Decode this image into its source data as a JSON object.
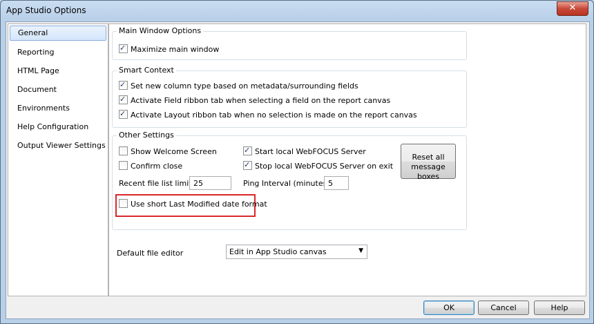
{
  "window": {
    "title": "App Studio Options"
  },
  "nav": {
    "items": [
      {
        "label": "General",
        "selected": true
      },
      {
        "label": "Reporting"
      },
      {
        "label": "HTML Page"
      },
      {
        "label": "Document"
      },
      {
        "label": "Environments"
      },
      {
        "label": "Help Configuration"
      },
      {
        "label": "Output Viewer Settings"
      }
    ]
  },
  "main_window": {
    "legend": "Main Window Options",
    "maximize": {
      "label": "Maximize main window",
      "checked": true
    }
  },
  "smart_context": {
    "legend": "Smart Context",
    "options": [
      {
        "label": "Set new column type based on metadata/surrounding fields",
        "checked": true
      },
      {
        "label": "Activate Field ribbon tab when selecting a field on the report canvas",
        "checked": true
      },
      {
        "label": "Activate Layout ribbon tab when no selection is made on the report canvas",
        "checked": true
      }
    ]
  },
  "other": {
    "legend": "Other Settings",
    "show_welcome": {
      "label": "Show Welcome Screen",
      "checked": false
    },
    "confirm_close": {
      "label": "Confirm close",
      "checked": false
    },
    "start_server": {
      "label": "Start local WebFOCUS Server",
      "checked": true
    },
    "stop_server": {
      "label": "Stop local WebFOCUS Server on exit",
      "checked": true
    },
    "reset_button": {
      "line1": "Reset all",
      "line2": "message boxes"
    },
    "recent_label": "Recent file list limit:",
    "recent_value": "25",
    "ping_label": "Ping Interval (minutes)",
    "ping_value": "5",
    "short_date": {
      "label": "Use short Last Modified date format",
      "checked": false
    }
  },
  "editor": {
    "label": "Default file editor",
    "value": "Edit in App Studio canvas"
  },
  "footer": {
    "ok": "OK",
    "cancel": "Cancel",
    "help": "Help"
  },
  "colors": {
    "highlight": "#d9262a",
    "selected_nav": "#d4e6fb"
  }
}
